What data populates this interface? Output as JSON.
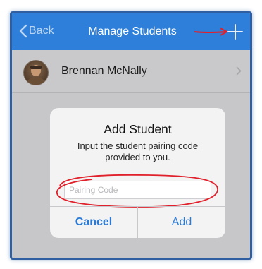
{
  "navbar": {
    "back_label": "Back",
    "title": "Manage Students",
    "add_icon": "plus-icon",
    "color": "#2d7fd9"
  },
  "students": [
    {
      "name": "Brennan McNally"
    }
  ],
  "dialog": {
    "title": "Add Student",
    "message": "Input the student pairing code provided to you.",
    "input_placeholder": "Pairing Code",
    "input_value": "",
    "cancel_label": "Cancel",
    "add_label": "Add"
  },
  "annotations": {
    "arrow_color": "#e0212b",
    "circle_color": "#e0212b"
  }
}
